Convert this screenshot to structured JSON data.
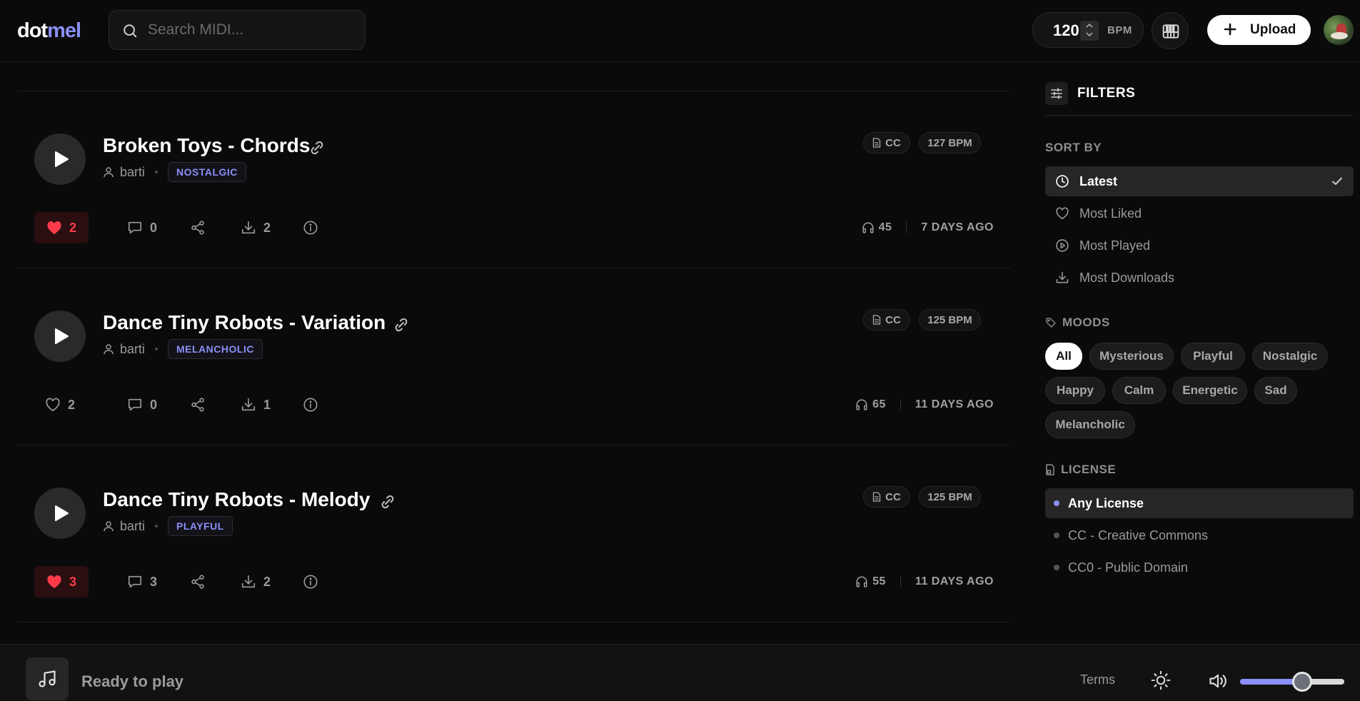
{
  "header": {
    "logo_a": "dot",
    "logo_b": "mel",
    "search_placeholder": "Search MIDI...",
    "bpm_value": "120",
    "bpm_label": "BPM",
    "upload_label": "Upload"
  },
  "tracks": [
    {
      "title": "Broken Toys - Chords",
      "author": "barti",
      "mood": "NOSTALGIC",
      "license": "CC",
      "bpm": "127 BPM",
      "likes": "2",
      "liked": true,
      "comments": "0",
      "downloads": "2",
      "plays": "45",
      "age": "7 DAYS AGO"
    },
    {
      "title": "Dance Tiny Robots - Variation",
      "author": "barti",
      "mood": "MELANCHOLIC",
      "license": "CC",
      "bpm": "125 BPM",
      "likes": "2",
      "liked": false,
      "comments": "0",
      "downloads": "1",
      "plays": "65",
      "age": "11 DAYS AGO"
    },
    {
      "title": "Dance Tiny Robots - Melody",
      "author": "barti",
      "mood": "PLAYFUL",
      "license": "CC",
      "bpm": "125 BPM",
      "likes": "3",
      "liked": true,
      "comments": "3",
      "downloads": "2",
      "plays": "55",
      "age": "11 DAYS AGO"
    }
  ],
  "sidebar": {
    "filters_title": "FILTERS",
    "sort_label": "SORT BY",
    "sort_options": [
      {
        "label": "Latest",
        "icon": "clock-icon",
        "active": true
      },
      {
        "label": "Most Liked",
        "icon": "heart-icon",
        "active": false
      },
      {
        "label": "Most Played",
        "icon": "play-circle-icon",
        "active": false
      },
      {
        "label": "Most Downloads",
        "icon": "download-icon",
        "active": false
      }
    ],
    "moods_label": "MOODS",
    "moods": [
      {
        "label": "All",
        "active": true
      },
      {
        "label": "Mysterious",
        "active": false
      },
      {
        "label": "Playful",
        "active": false
      },
      {
        "label": "Nostalgic",
        "active": false
      },
      {
        "label": "Happy",
        "active": false
      },
      {
        "label": "Calm",
        "active": false
      },
      {
        "label": "Energetic",
        "active": false
      },
      {
        "label": "Sad",
        "active": false
      },
      {
        "label": "Melancholic",
        "active": false
      }
    ],
    "license_label": "LICENSE",
    "licenses": [
      {
        "label": "Any License",
        "active": true
      },
      {
        "label": "CC - Creative Commons",
        "active": false
      },
      {
        "label": "CC0 - Public Domain",
        "active": false
      }
    ]
  },
  "player": {
    "status": "Ready to play",
    "terms": "Terms",
    "volume": 0.62
  },
  "colors": {
    "accent": "#8b8ff7",
    "like": "#ff3b4a",
    "background": "#0a0a0a"
  }
}
